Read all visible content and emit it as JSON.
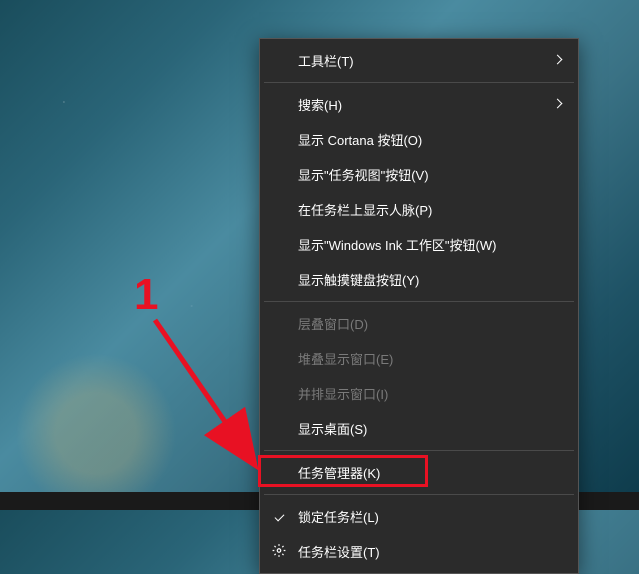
{
  "annotation": {
    "number": "1"
  },
  "menu": {
    "toolbars": "工具栏(T)",
    "search": "搜索(H)",
    "show_cortana": "显示 Cortana 按钮(O)",
    "show_task_view": "显示\"任务视图\"按钮(V)",
    "show_people": "在任务栏上显示人脉(P)",
    "show_ink": "显示\"Windows Ink 工作区\"按钮(W)",
    "show_touch_keyboard": "显示触摸键盘按钮(Y)",
    "cascade_windows": "层叠窗口(D)",
    "stack_windows": "堆叠显示窗口(E)",
    "side_by_side": "并排显示窗口(I)",
    "show_desktop": "显示桌面(S)",
    "task_manager": "任务管理器(K)",
    "lock_taskbar": "锁定任务栏(L)",
    "taskbar_settings": "任务栏设置(T)"
  }
}
